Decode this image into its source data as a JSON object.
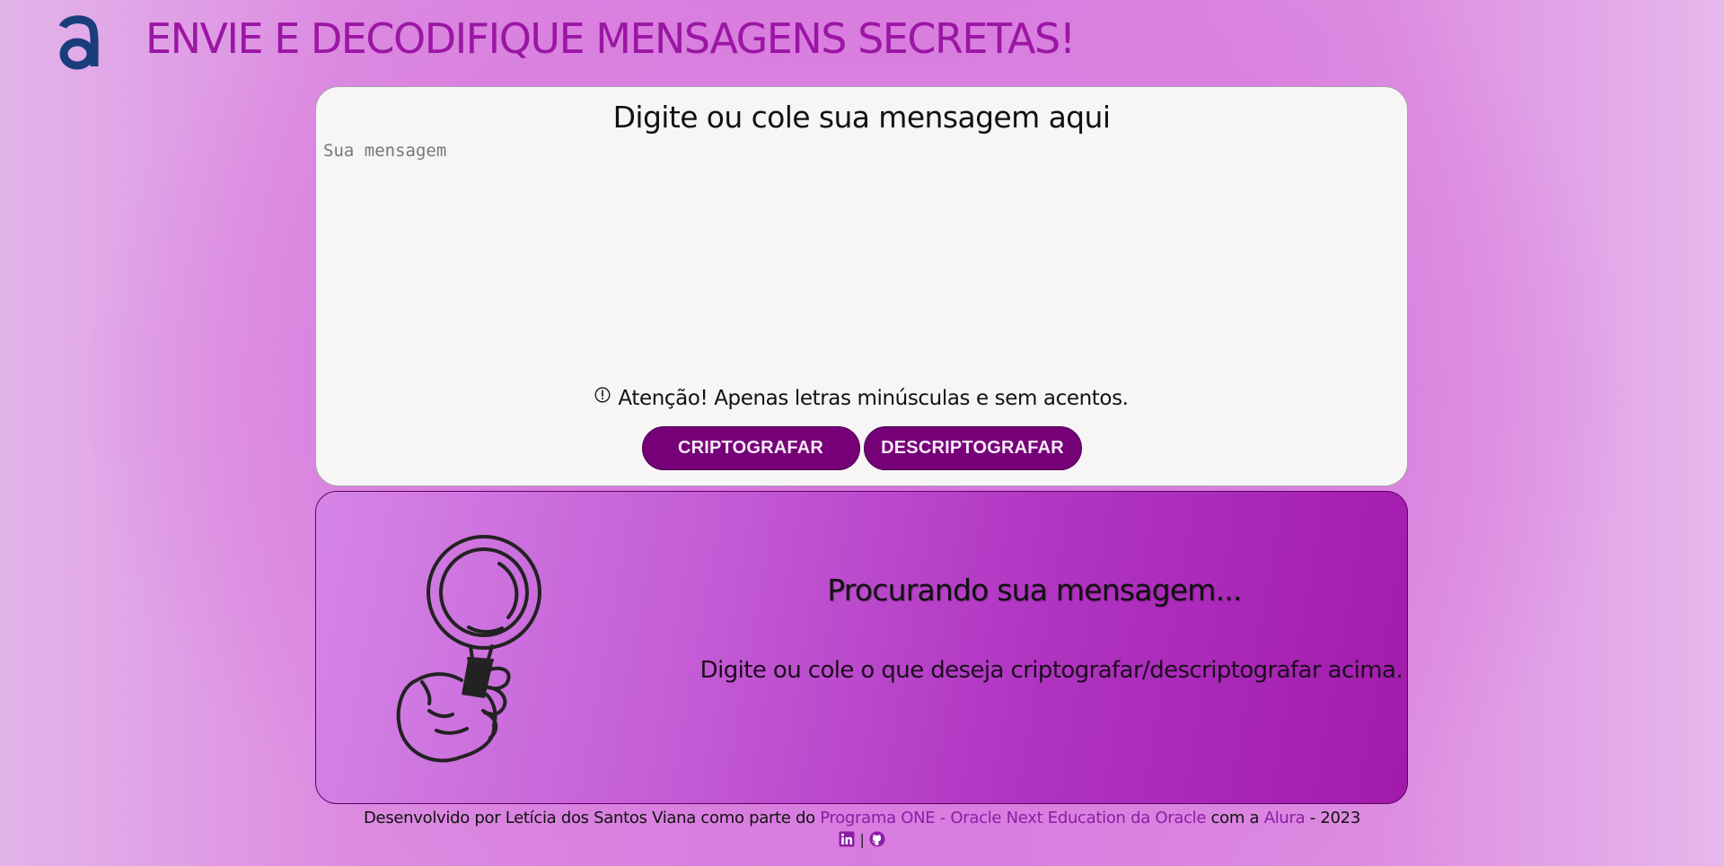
{
  "header": {
    "logo_icon": "alura-logo-icon",
    "title": "ENVIE E DECODIFIQUE MENSAGENS SECRETAS!"
  },
  "input_card": {
    "heading": "Digite ou cole sua mensagem aqui",
    "message_placeholder": "Sua mensagem",
    "message_value": "",
    "warning_icon": "exclamation-circle-icon",
    "warning_text": "Atenção! Apenas letras minúsculas e sem acentos.",
    "encrypt_label": "CRIPTOGRAFAR",
    "decrypt_label": "DESCRIPTOGRAFAR"
  },
  "output_card": {
    "illustration": "hand-holding-magnifier-icon",
    "heading": "Procurando sua mensagem...",
    "text": "Digite ou cole o que deseja criptografar/descriptografar acima."
  },
  "footer": {
    "prefix": "Desenvolvido por Letícia dos Santos Viana como parte do ",
    "program_link": "Programa ONE - Oracle Next Education da Oracle",
    "middle": " com a ",
    "alura_link": "Alura",
    "suffix": " - 2023",
    "separator": "|",
    "linkedin_icon": "linkedin-icon",
    "github_icon": "github-icon"
  },
  "colors": {
    "title": "#9b16a4",
    "button": "#760078",
    "link": "#8b1da6",
    "card_background": "#f8f5f7"
  }
}
